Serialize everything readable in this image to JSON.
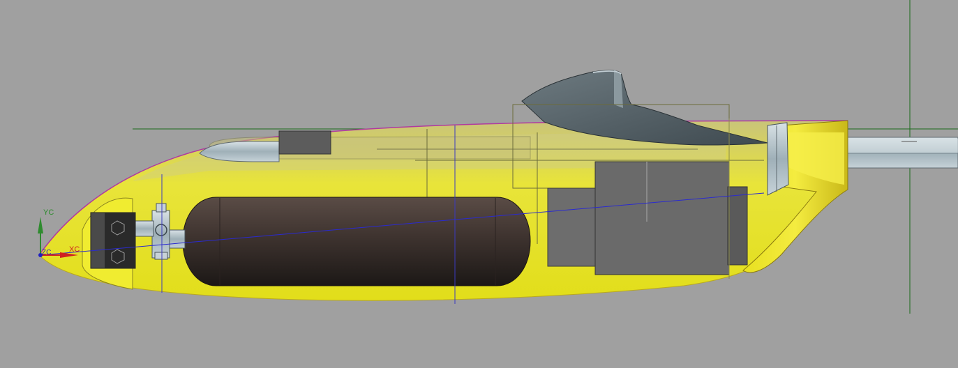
{
  "viewport": {
    "background": "#a0a0a0",
    "colors": {
      "hull_fill": "#e6e21e",
      "tank_fill": "#3a302c",
      "steel": "#5f6a70",
      "box_gray": "#6d6d6d",
      "outline_magenta": "#b03aa0",
      "datum_green": "#1a6a1a",
      "datum_blue": "#2a2ad0"
    }
  },
  "triad": {
    "y_label": "YC",
    "x_label": "XC",
    "z_label": "ZC",
    "y_color": "#2e8b2e",
    "x_color": "#d02020",
    "z_color": "#2020c0"
  }
}
